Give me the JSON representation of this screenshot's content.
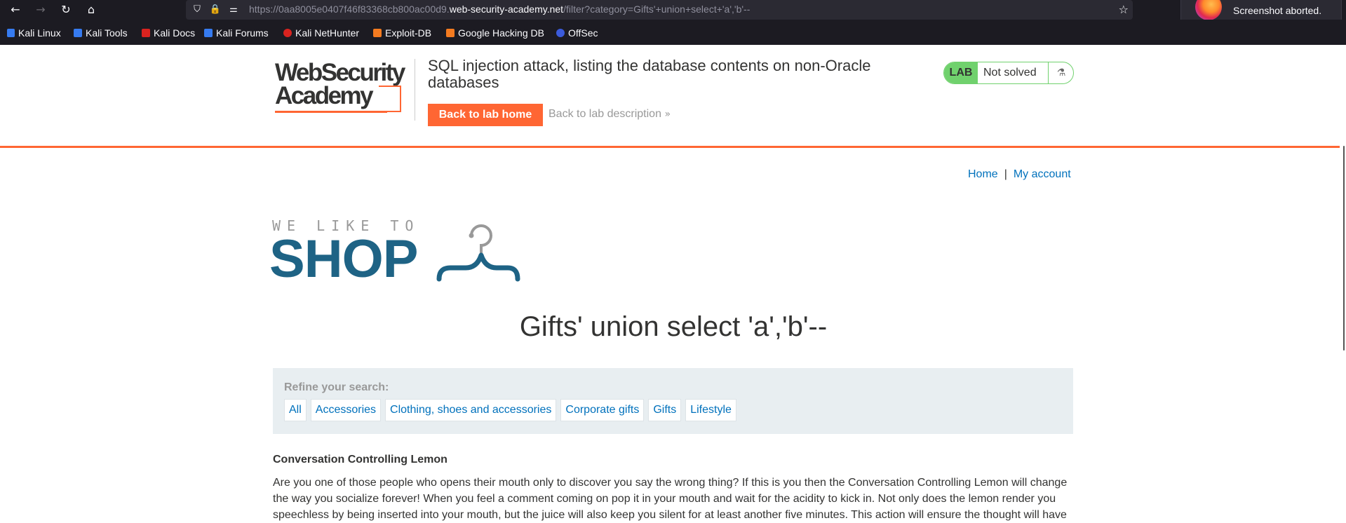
{
  "browser": {
    "url_prefix": "https://0aa8005e0407f46f83368cb800ac00d9.",
    "url_domain": "web-security-academy.net",
    "url_path": "/filter?category=Gifts'+union+select+'a','b'--",
    "notification": "Screenshot aborted.",
    "bookmarks": [
      "Kali Linux",
      "Kali Tools",
      "Kali Docs",
      "Kali Forums",
      "Kali NetHunter",
      "Exploit-DB",
      "Google Hacking DB",
      "OffSec"
    ]
  },
  "lab": {
    "logo_line1": "WebSecurity",
    "logo_line2": "Academy",
    "title": "SQL injection attack, listing the database contents on non-Oracle databases",
    "back_home": "Back to lab home",
    "back_description": "Back to lab description",
    "badge_lab": "LAB",
    "badge_status": "Not solved"
  },
  "nav": {
    "home": "Home",
    "separator": "|",
    "account": "My account"
  },
  "shop_logo": {
    "tagline": "WE LIKE TO",
    "word": "SHOP"
  },
  "search_title": "Gifts' union select 'a','b'--",
  "filters": {
    "label": "Refine your search:",
    "categories": [
      "All",
      "Accessories",
      "Clothing, shoes and accessories",
      "Corporate gifts",
      "Gifts",
      "Lifestyle"
    ]
  },
  "product": {
    "name": "Conversation Controlling Lemon",
    "description": "Are you one of those people who opens their mouth only to discover you say the wrong thing? If this is you then the Conversation Controlling Lemon will change the way you socialize forever! When you feel a comment coming on pop it in your mouth and wait for the acidity to kick in. Not only does the lemon render you speechless by being inserted into your mouth, but the juice will also keep you silent for at least another five minutes. This action will ensure the thought will have"
  },
  "colors": {
    "accent_orange": "#ff6633",
    "link_blue": "#0071bc",
    "lab_green": "#70d16d",
    "shop_blue": "#1e6385"
  }
}
